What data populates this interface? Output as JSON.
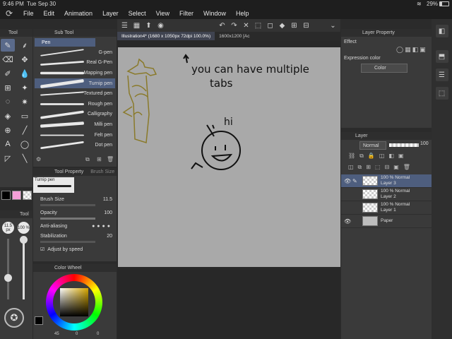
{
  "status": {
    "time": "9:46 PM",
    "date": "Tue Sep 30",
    "battery": "29%"
  },
  "menu": [
    "File",
    "Edit",
    "Animation",
    "Layer",
    "Select",
    "View",
    "Filter",
    "Window",
    "Help"
  ],
  "tool_panel": {
    "title": "Tool"
  },
  "sub_tool": {
    "title": "Sub Tool",
    "group": "Pen",
    "brushes": [
      "G-pen",
      "Real G-Pen",
      "Mapping pen",
      "Turnip pen",
      "Textured pen",
      "Rough pen",
      "Calligraphy",
      "Milli pen",
      "Felt pen",
      "Dot pen"
    ],
    "selected": "Turnip pen"
  },
  "tool_property": {
    "title": "Tool Property",
    "tab2": "Brush Size",
    "preview_label": "Turnip pen",
    "brush_size_label": "Brush Size",
    "brush_size": "11.5",
    "opacity_label": "Opacity",
    "opacity": "100",
    "antialias_label": "Anti-aliasing",
    "stabilization_label": "Stabilization",
    "stabilization": "20",
    "adjust_label": "Adjust by speed"
  },
  "size_bar": {
    "size": "11.5 px",
    "opacity": "100 %",
    "title": "Tool"
  },
  "color_wheel": {
    "title": "Color Wheel",
    "h": "45",
    "s": "0",
    "v": "0"
  },
  "tabs": [
    {
      "label": "Illustration4* (1680 x 1050px 72dpi 100.0%)"
    },
    {
      "label": "1600x1200 [Ac"
    }
  ],
  "canvas_text": {
    "note_line1": "you can have multiple",
    "note_line2": "tabs",
    "hi": "hi"
  },
  "layer_property": {
    "title": "Layer Property",
    "effect": "Effect",
    "expression_color_label": "Expression color",
    "expression_color": "Color"
  },
  "layer_panel": {
    "title": "Layer",
    "blend": "Normal",
    "opacity": "100",
    "layers": [
      {
        "name": "Layer 3",
        "mode": "100 % Normal",
        "selected": true
      },
      {
        "name": "Layer 2",
        "mode": "100 % Normal",
        "selected": false
      },
      {
        "name": "Layer 1",
        "mode": "100 % Normal",
        "selected": false
      },
      {
        "name": "Paper",
        "mode": "",
        "selected": false
      }
    ]
  },
  "colors": {
    "accent": "#4e5e7e",
    "canvas": "#a9a9a9",
    "sketch": "#8a7a2a"
  }
}
